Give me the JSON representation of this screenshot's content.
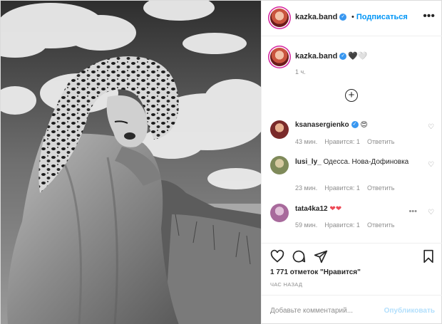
{
  "header": {
    "username": "kazka.band",
    "follow_separator": "•",
    "follow_label": "Подписаться",
    "more_icon": "•••"
  },
  "caption": {
    "username": "kazka.band",
    "hearts": "🖤🤍",
    "time": "1 ч."
  },
  "load_more_icon": "+",
  "comments": [
    {
      "username": "ksanasergienko",
      "verified": true,
      "text": "😍",
      "time": "43 мин.",
      "likes": "Нравится: 1",
      "reply": "Ответить",
      "avatar_color": "#7a2a2a"
    },
    {
      "username": "lusi_ly_",
      "verified": false,
      "text": "Одесса. Нова-Дофиновка",
      "time": "23 мин.",
      "likes": "Нравится: 1",
      "reply": "Ответить",
      "avatar_color": "#7f8a5a"
    },
    {
      "username": "tata4ka12",
      "verified": false,
      "text": "❤❤",
      "time": "59 мин.",
      "likes": "Нравится: 1",
      "reply": "Ответить",
      "avatar_color": "#a86a9c"
    }
  ],
  "stats": {
    "likes_text": "1 771 отметок \"Нравится\"",
    "time_ago": "ЧАС НАЗАД"
  },
  "add_comment": {
    "placeholder": "Добавьте комментарий...",
    "publish_label": "Опубликовать"
  },
  "colors": {
    "accent": "#0095f6",
    "verified": "#3897f0",
    "heart_red": "#ed4956",
    "publish_disabled": "#b2dffc"
  }
}
